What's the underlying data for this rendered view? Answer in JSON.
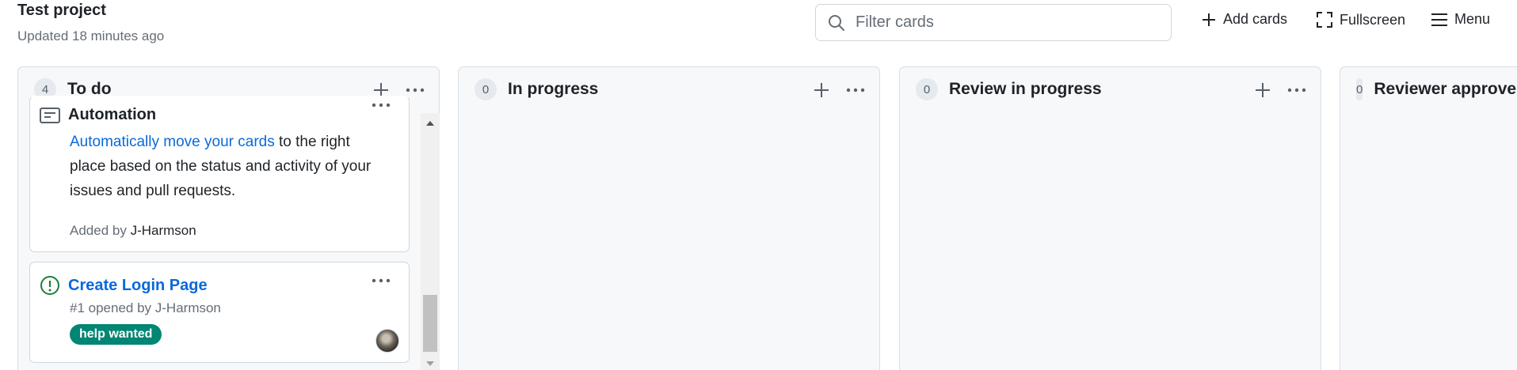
{
  "header": {
    "project_title": "Test project",
    "updated": "Updated 18 minutes ago",
    "filter_placeholder": "Filter cards",
    "add_cards": "Add cards",
    "fullscreen": "Fullscreen",
    "menu": "Menu"
  },
  "columns": [
    {
      "count": "4",
      "name": "To do",
      "cards": [
        {
          "type": "note",
          "title": "Automation",
          "link_text": "Automatically move your cards",
          "body_rest": " to the right place based on the status and activity of your issues and pull requests.",
          "added_prefix": "Added by ",
          "added_by": "J-Harmson"
        },
        {
          "type": "issue",
          "title": "Create Login Page",
          "meta": "#1 opened by J-Harmson",
          "label": "help wanted",
          "label_color": "#008672"
        }
      ]
    },
    {
      "count": "0",
      "name": "In progress"
    },
    {
      "count": "0",
      "name": "Review in progress"
    },
    {
      "count": "0",
      "name": "Reviewer approved"
    }
  ],
  "colors": {
    "link": "#0969da",
    "open_issue": "#1a7f37",
    "column_bg": "#f6f8fa"
  },
  "icons": [
    "search-icon",
    "plus-icon",
    "fullscreen-icon",
    "hamburger-menu-icon",
    "more-horizontal-icon",
    "note-icon",
    "issue-opened-icon"
  ]
}
